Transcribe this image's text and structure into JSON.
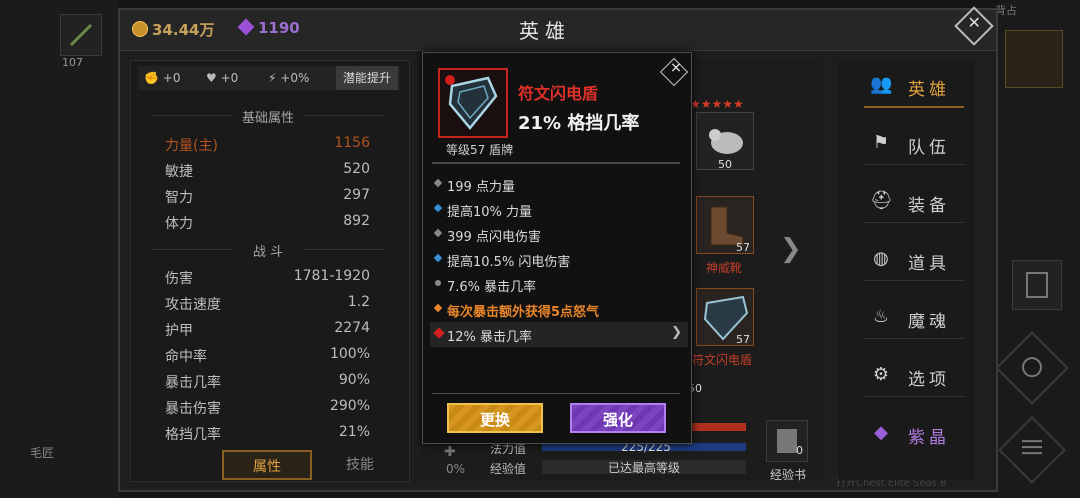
{
  "header": {
    "gold": "34.44万",
    "gems": "1190",
    "title": "英雄"
  },
  "outer": {
    "left_slot_num": "107",
    "left_bottom_text": "毛匠",
    "right_top_text": "背占"
  },
  "left_panel": {
    "bonuses": [
      "+0",
      "+0",
      "+0%"
    ],
    "potential_button": "潜能提升",
    "basic_title": "基础属性",
    "basic_stats": [
      {
        "label": "力量(主)",
        "value": "1156"
      },
      {
        "label": "敏捷",
        "value": "520"
      },
      {
        "label": "智力",
        "value": "297"
      },
      {
        "label": "体力",
        "value": "892"
      }
    ],
    "combat_title": "战 斗",
    "combat_stats": [
      {
        "label": "伤害",
        "value": "1781-1920"
      },
      {
        "label": "攻击速度",
        "value": "1.2"
      },
      {
        "label": "护甲",
        "value": "2274"
      },
      {
        "label": "命中率",
        "value": "100%"
      },
      {
        "label": "暴击几率",
        "value": "90%"
      },
      {
        "label": "暴击伤害",
        "value": "290%"
      },
      {
        "label": "格挡几率",
        "value": "21%"
      }
    ],
    "tabs": [
      "属性",
      "技能"
    ]
  },
  "hero_panel": {
    "pet_level": "50",
    "boots_level": "57",
    "boots_name": "神威靴",
    "shield_level": "57",
    "shield_name": "符文闪电盾",
    "side_num": "50",
    "mana_label": "法力值",
    "mana_value": "225/225",
    "exp_label": "经验值",
    "exp_value": "已达最高等级",
    "percent": "0%",
    "exp_book_count": "0",
    "exp_book_label": "经验书",
    "footer_text": "打开Chest Elite Seas 8"
  },
  "nav": [
    {
      "label": "英雄",
      "icon": "users-icon",
      "glyph": "👥"
    },
    {
      "label": "队伍",
      "icon": "flag-icon",
      "glyph": "⚑"
    },
    {
      "label": "装备",
      "icon": "helmet-icon",
      "glyph": "⛑"
    },
    {
      "label": "道具",
      "icon": "bag-icon",
      "glyph": "◍"
    },
    {
      "label": "魔魂",
      "icon": "flame-icon",
      "glyph": "♨"
    },
    {
      "label": "选项",
      "icon": "gear-icon",
      "glyph": "⚙"
    },
    {
      "label": "紫晶",
      "icon": "amethyst-icon",
      "glyph": "◆"
    }
  ],
  "popup": {
    "item_name": "符文闪电盾",
    "main_stat": "21% 格挡几率",
    "level_text": "等级57 盾牌",
    "attributes": [
      {
        "text": "199 点力量",
        "bullet": "#8a8a8a",
        "color": "#dadada"
      },
      {
        "text": "提高10% 力量",
        "bullet": "#3a8fd8",
        "color": "#dadada"
      },
      {
        "text": "399 点闪电伤害",
        "bullet": "#8a8a8a",
        "color": "#dadada"
      },
      {
        "text": "提高10.5% 闪电伤害",
        "bullet": "#3a8fd8",
        "color": "#dadada"
      },
      {
        "text": "7.6% 暴击几率",
        "bullet": "#8a8a8a",
        "color": "#dadada"
      },
      {
        "text": "每次暴击额外获得5点怒气",
        "bullet": "#e8852a",
        "color": "#e8852a"
      },
      {
        "text": "12% 暴击几率",
        "bullet": "#d21e1e",
        "color": "#dadada"
      }
    ],
    "btn_replace": "更换",
    "btn_upgrade": "强化"
  }
}
